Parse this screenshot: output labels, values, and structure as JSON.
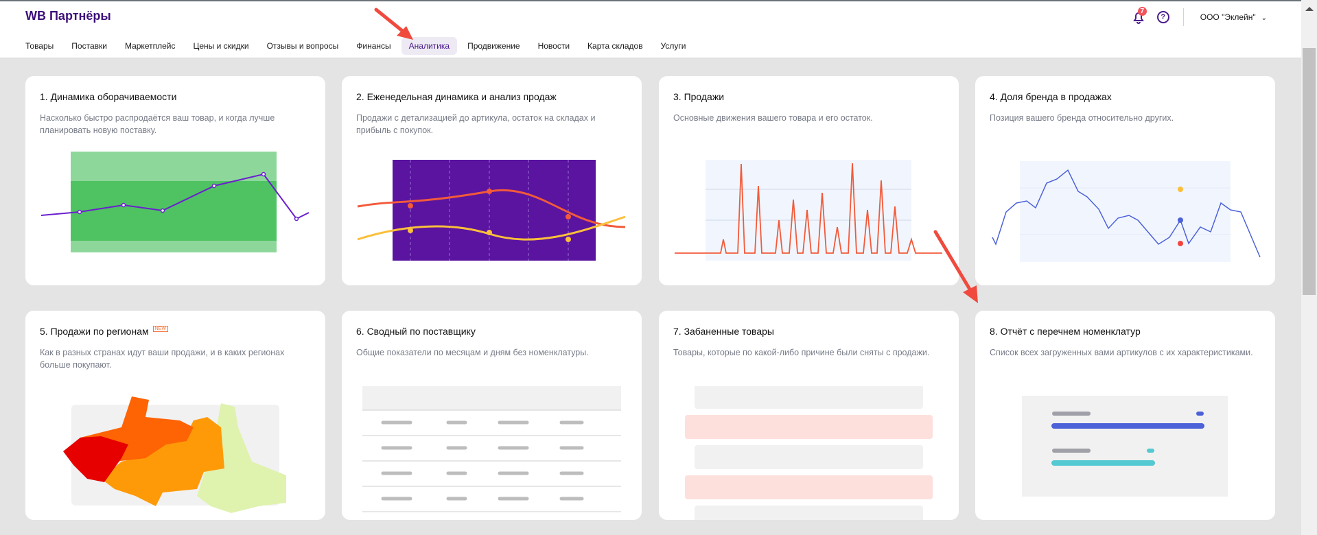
{
  "header": {
    "logo": "WB Партнёры",
    "notifications_count": "7",
    "help": "?",
    "org": "ООО \"Эклейн\"",
    "org_chevron": "⌄"
  },
  "nav": [
    "Товары",
    "Поставки",
    "Маркетплейс",
    "Цены и скидки",
    "Отзывы и вопросы",
    "Финансы",
    "Аналитика",
    "Продвижение",
    "Новости",
    "Карта складов",
    "Услуги"
  ],
  "active_nav": "Аналитика",
  "cards": [
    {
      "title": "1. Динамика оборачиваемости",
      "desc": "Насколько быстро распродаётся ваш товар, и когда лучше планировать новую поставку."
    },
    {
      "title": "2. Еженедельная динамика и анализ продаж",
      "desc": "Продажи с детализацией до артикула, остаток на складах и прибыль с покупок."
    },
    {
      "title": "3. Продажи",
      "desc": "Основные движения вашего товара и его остаток."
    },
    {
      "title": "4. Доля бренда в продажах",
      "desc": "Позиция вашего бренда относительно других."
    },
    {
      "title": "5. Продажи по регионам",
      "badge": "NEW",
      "desc": "Как в разных странах идут ваши продажи, и в каких регионах больше покупают."
    },
    {
      "title": "6. Сводный по поставщику",
      "desc": "Общие показатели по месяцам и дням без номенклатуры."
    },
    {
      "title": "7. Забаненные товары",
      "desc": "Товары, которые по какой-либо причине были сняты с продажи."
    },
    {
      "title": "8. Отчёт с перечнем номенклатур",
      "desc": "Список всех загруженных вами артикулов с их характеристиками."
    }
  ],
  "colors": {
    "brand": "#3c0f7a",
    "annotation_arrow": "#f04a3e",
    "accent_purple": "#5a14a0"
  }
}
